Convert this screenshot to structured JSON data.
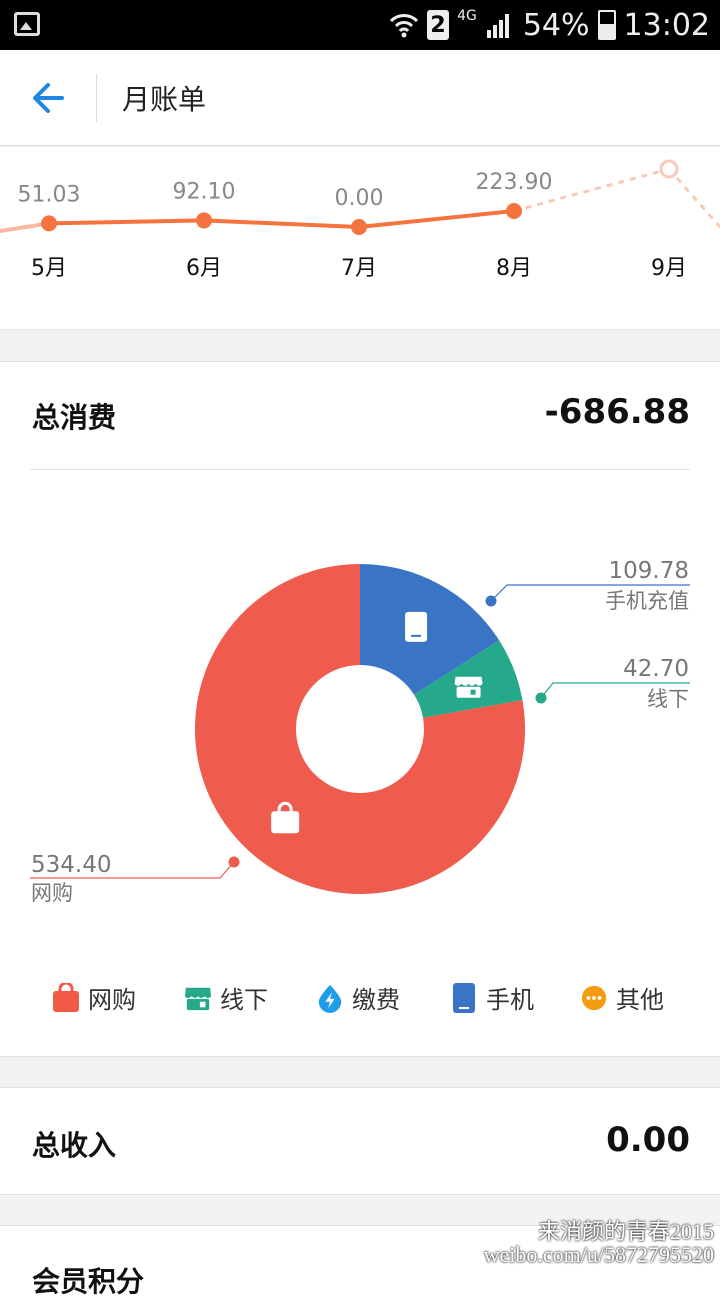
{
  "status_bar": {
    "sim": "2",
    "network": "4G",
    "battery": "54%",
    "time": "13:02"
  },
  "header": {
    "title": "月账单"
  },
  "trend": {
    "points": [
      {
        "month": "5月",
        "value": "51.03",
        "v": 51.03
      },
      {
        "month": "6月",
        "value": "92.10",
        "v": 92.1
      },
      {
        "month": "7月",
        "value": "0.00",
        "v": 0.0
      },
      {
        "month": "8月",
        "value": "223.90",
        "v": 223.9
      },
      {
        "month": "9月",
        "value": "",
        "v": null
      }
    ],
    "line_color": "#f4733f"
  },
  "expense": {
    "label": "总消费",
    "total": "-686.88"
  },
  "pie": {
    "slices": [
      {
        "name": "手机充值",
        "value": 109.78,
        "value_text": "109.78",
        "color": "#3a74c4",
        "icon": "phone-icon"
      },
      {
        "name": "线下",
        "value": 42.7,
        "value_text": "42.70",
        "color": "#26a88a",
        "icon": "store-icon"
      },
      {
        "name": "网购",
        "value": 534.4,
        "value_text": "534.40",
        "color": "#ef5b4c",
        "icon": "shopping-bag-icon"
      }
    ]
  },
  "legend": [
    {
      "label": "网购",
      "color": "#f05a47",
      "icon": "shopping-bag-icon"
    },
    {
      "label": "线下",
      "color": "#26a88a",
      "icon": "store-icon"
    },
    {
      "label": "缴费",
      "color": "#1e9ee8",
      "icon": "bolt-drop-icon"
    },
    {
      "label": "手机",
      "color": "#3a74c4",
      "icon": "phone-icon"
    },
    {
      "label": "其他",
      "color": "#f39c12",
      "icon": "more-dots-icon"
    }
  ],
  "income": {
    "label": "总收入",
    "total": "0.00"
  },
  "points_section": {
    "label": "会员积分"
  },
  "watermark": {
    "line1": "来消颜的青春2015",
    "line2": "weibo.com/u/5872795520"
  }
}
